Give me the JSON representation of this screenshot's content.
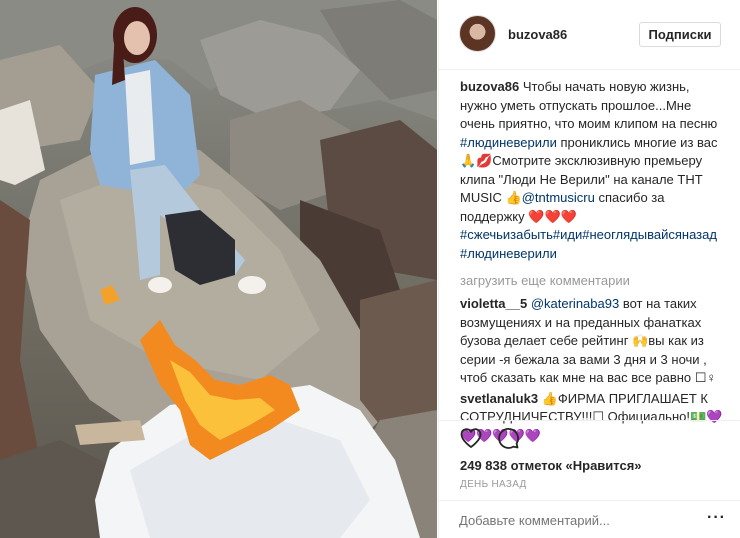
{
  "header": {
    "username": "buzova86",
    "follow_label": "Подписки"
  },
  "caption": {
    "user": "buzova86",
    "text_1": "Чтобы начать новую жизнь, нужно уметь отпускать прошлое...Мне очень приятно, что моим клипом на песню ",
    "tag_1": "#людиневерили",
    "text_2": " прониклись многие из вас🙏💋Смотрите эксклюзивную премьеру клипа \"Люди Не Верили\" на канале ТНТ MUSIC 👍",
    "mention_1": "@tntmusicru",
    "text_3": " спасибо за поддержку ❤️❤️❤️",
    "tags_2": "#сжечьизабыть#иди#неоглядывайсяназад #людиневерили"
  },
  "load_more_label": "загрузить еще комментарии",
  "comments": [
    {
      "user": "violetta__5",
      "mention": "@katerinaba93",
      "text": " вот на таких возмущениях и на преданных фанатках бузова делает себе рейтинг 🙌вы как из серии -я бежала за вами 3 дня и 3 ночи , чтоб сказать как мне на вас все равно ☐♀"
    },
    {
      "user": "svetlanaluk3",
      "text": " 👍ФИРМА ПРИГЛАШАЕТ К СОТРУДНИЧЕСТВУ!!!☐ Официально!💵💜💜💜💜💜💜"
    }
  ],
  "actions": {
    "likes": "249 838 отметок «Нравится»",
    "time": "ДЕНЬ НАЗАД"
  },
  "add_comment": {
    "placeholder": "Добавьте комментарий..."
  },
  "icons": {
    "like": "heart-icon",
    "comment": "comment-icon",
    "more": "more-options-icon"
  },
  "colors": {
    "link": "#003569",
    "muted": "#999999",
    "divider": "#efefef"
  }
}
